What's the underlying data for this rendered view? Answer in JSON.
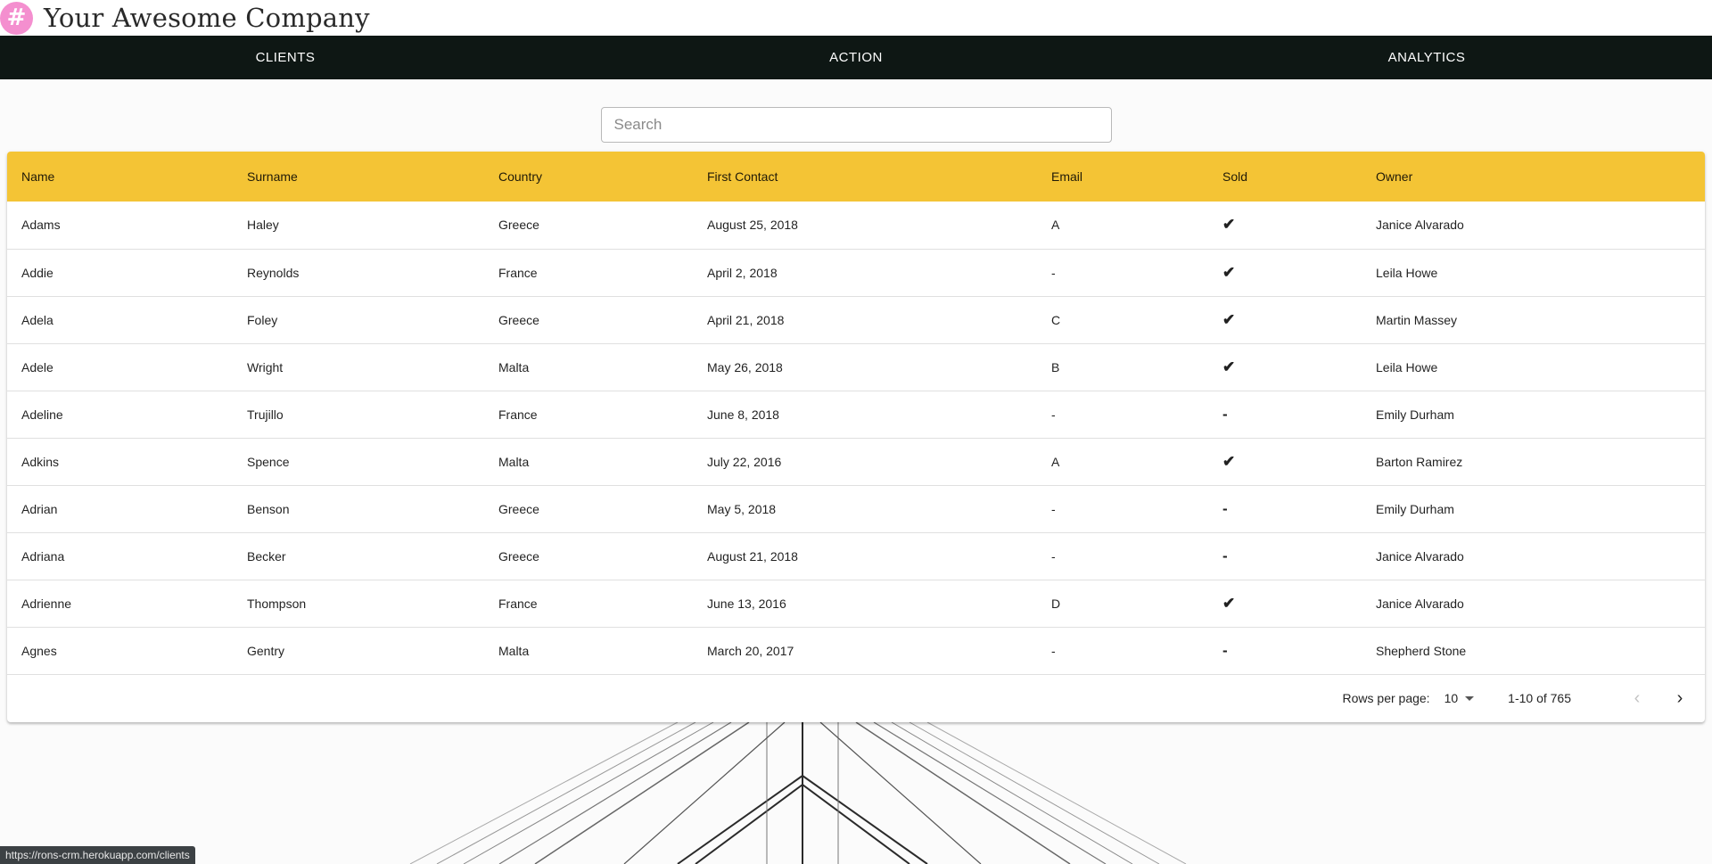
{
  "app": {
    "logo_glyph": "#",
    "company_name": "Your Awesome Company",
    "brand_color": "#f48fcf",
    "nav_color": "#0e1714",
    "header_color": "#f4c435"
  },
  "nav": {
    "items": [
      {
        "label": "CLIENTS"
      },
      {
        "label": "ACTION"
      },
      {
        "label": "ANALYTICS"
      }
    ]
  },
  "search": {
    "placeholder": "Search",
    "value": ""
  },
  "table": {
    "columns": [
      "Name",
      "Surname",
      "Country",
      "First Contact",
      "Email",
      "Sold",
      "Owner"
    ],
    "rows": [
      {
        "name": "Adams",
        "surname": "Haley",
        "country": "Greece",
        "first_contact": "August 25, 2018",
        "email": "A",
        "sold": "✔",
        "owner": "Janice Alvarado"
      },
      {
        "name": "Addie",
        "surname": "Reynolds",
        "country": "France",
        "first_contact": "April 2, 2018",
        "email": "-",
        "sold": "✔",
        "owner": "Leila Howe"
      },
      {
        "name": "Adela",
        "surname": "Foley",
        "country": "Greece",
        "first_contact": "April 21, 2018",
        "email": "C",
        "sold": "✔",
        "owner": "Martin Massey"
      },
      {
        "name": "Adele",
        "surname": "Wright",
        "country": "Malta",
        "first_contact": "May 26, 2018",
        "email": "B",
        "sold": "✔",
        "owner": "Leila Howe"
      },
      {
        "name": "Adeline",
        "surname": "Trujillo",
        "country": "France",
        "first_contact": "June 8, 2018",
        "email": "-",
        "sold": "-",
        "owner": "Emily Durham"
      },
      {
        "name": "Adkins",
        "surname": "Spence",
        "country": "Malta",
        "first_contact": "July 22, 2016",
        "email": "A",
        "sold": "✔",
        "owner": "Barton Ramirez"
      },
      {
        "name": "Adrian",
        "surname": "Benson",
        "country": "Greece",
        "first_contact": "May 5, 2018",
        "email": "-",
        "sold": "-",
        "owner": "Emily Durham"
      },
      {
        "name": "Adriana",
        "surname": "Becker",
        "country": "Greece",
        "first_contact": "August 21, 2018",
        "email": "-",
        "sold": "-",
        "owner": "Janice Alvarado"
      },
      {
        "name": "Adrienne",
        "surname": "Thompson",
        "country": "France",
        "first_contact": "June 13, 2016",
        "email": "D",
        "sold": "✔",
        "owner": "Janice Alvarado"
      },
      {
        "name": "Agnes",
        "surname": "Gentry",
        "country": "Malta",
        "first_contact": "March 20, 2017",
        "email": "-",
        "sold": "-",
        "owner": "Shepherd Stone"
      }
    ]
  },
  "pagination": {
    "rows_per_page_label": "Rows per page:",
    "rows_per_page_value": "10",
    "range_text": "1-10 of 765",
    "prev_icon": "‹",
    "next_icon": "›"
  },
  "statusbar": {
    "url": "https://rons-crm.herokuapp.com/clients"
  }
}
